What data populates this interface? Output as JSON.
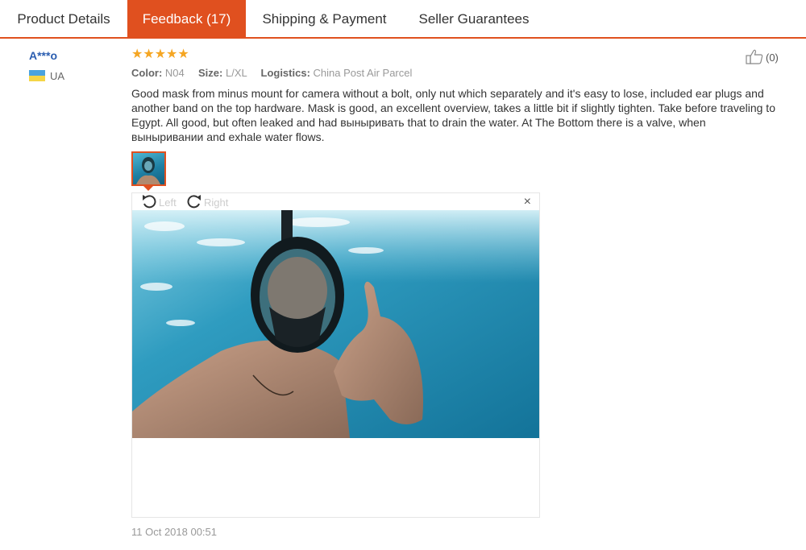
{
  "tabs": [
    {
      "label": "Product Details"
    },
    {
      "label": "Feedback (17)"
    },
    {
      "label": "Shipping & Payment"
    },
    {
      "label": "Seller Guarantees"
    }
  ],
  "active_tab": "Feedback (17)",
  "review": {
    "reviewer_name": "A***o",
    "country": "UA",
    "rating": 5,
    "stars": "★★★★★",
    "helpful_count": "(0)",
    "meta": {
      "color_label": "Color:",
      "color_value": "N04",
      "size_label": "Size:",
      "size_value": "L/XL",
      "logistics_label": "Logistics:",
      "logistics_value": "China Post Air Parcel"
    },
    "text": "Good mask from minus mount for camera without a bolt, only nut which separately and it's easy to lose, included ear plugs and another band on the top hardware. Mask is good, an excellent overview, takes a little bit if slightly tighten. Take before traveling to Egypt. All good, but often leaked and had выныривать that to drain the water. At The Bottom there is a valve, when выныривании and exhale water flows.",
    "date": "11 Oct 2018 00:51"
  },
  "viewer": {
    "rotate_left_label": "Left",
    "rotate_right_label": "Right",
    "close_symbol": "×"
  },
  "colors": {
    "accent": "#e0501f",
    "star": "#f5a623",
    "link": "#2a5db0"
  }
}
